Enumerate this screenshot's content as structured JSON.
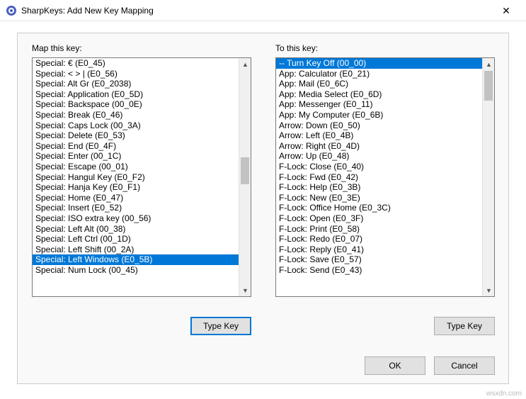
{
  "window": {
    "title": "SharpKeys: Add New Key Mapping",
    "icon_name": "sharpkeys-icon"
  },
  "left_panel": {
    "label": "Map this key:",
    "selected_index": 22,
    "items": [
      "Special: € (E0_45)",
      "Special: < > | (E0_56)",
      "Special: Alt Gr (E0_2038)",
      "Special: Application (E0_5D)",
      "Special: Backspace (00_0E)",
      "Special: Break (E0_46)",
      "Special: Caps Lock (00_3A)",
      "Special: Delete (E0_53)",
      "Special: End (E0_4F)",
      "Special: Enter (00_1C)",
      "Special: Escape (00_01)",
      "Special: Hangul Key (E0_F2)",
      "Special: Hanja Key (E0_F1)",
      "Special: Home (E0_47)",
      "Special: Insert (E0_52)",
      "Special: ISO extra key (00_56)",
      "Special: Left Alt (00_38)",
      "Special: Left Ctrl (00_1D)",
      "Special: Left Shift (00_2A)",
      "Special: Left Windows (E0_5B)",
      "Special: Num Lock (00_45)"
    ]
  },
  "right_panel": {
    "label": "To this key:",
    "selected_index": 0,
    "items": [
      "-- Turn Key Off (00_00)",
      "App: Calculator (E0_21)",
      "App: Mail (E0_6C)",
      "App: Media Select (E0_6D)",
      "App: Messenger (E0_11)",
      "App: My Computer (E0_6B)",
      "Arrow: Down (E0_50)",
      "Arrow: Left (E0_4B)",
      "Arrow: Right (E0_4D)",
      "Arrow: Up (E0_48)",
      "F-Lock: Close (E0_40)",
      "F-Lock: Fwd (E0_42)",
      "F-Lock: Help (E0_3B)",
      "F-Lock: New (E0_3E)",
      "F-Lock: Office Home (E0_3C)",
      "F-Lock: Open (E0_3F)",
      "F-Lock: Print (E0_58)",
      "F-Lock: Redo (E0_07)",
      "F-Lock: Reply (E0_41)",
      "F-Lock: Save (E0_57)",
      "F-Lock: Send (E0_43)"
    ]
  },
  "buttons": {
    "type_key": "Type Key",
    "ok": "OK",
    "cancel": "Cancel"
  },
  "watermark": "wsxdn.com"
}
